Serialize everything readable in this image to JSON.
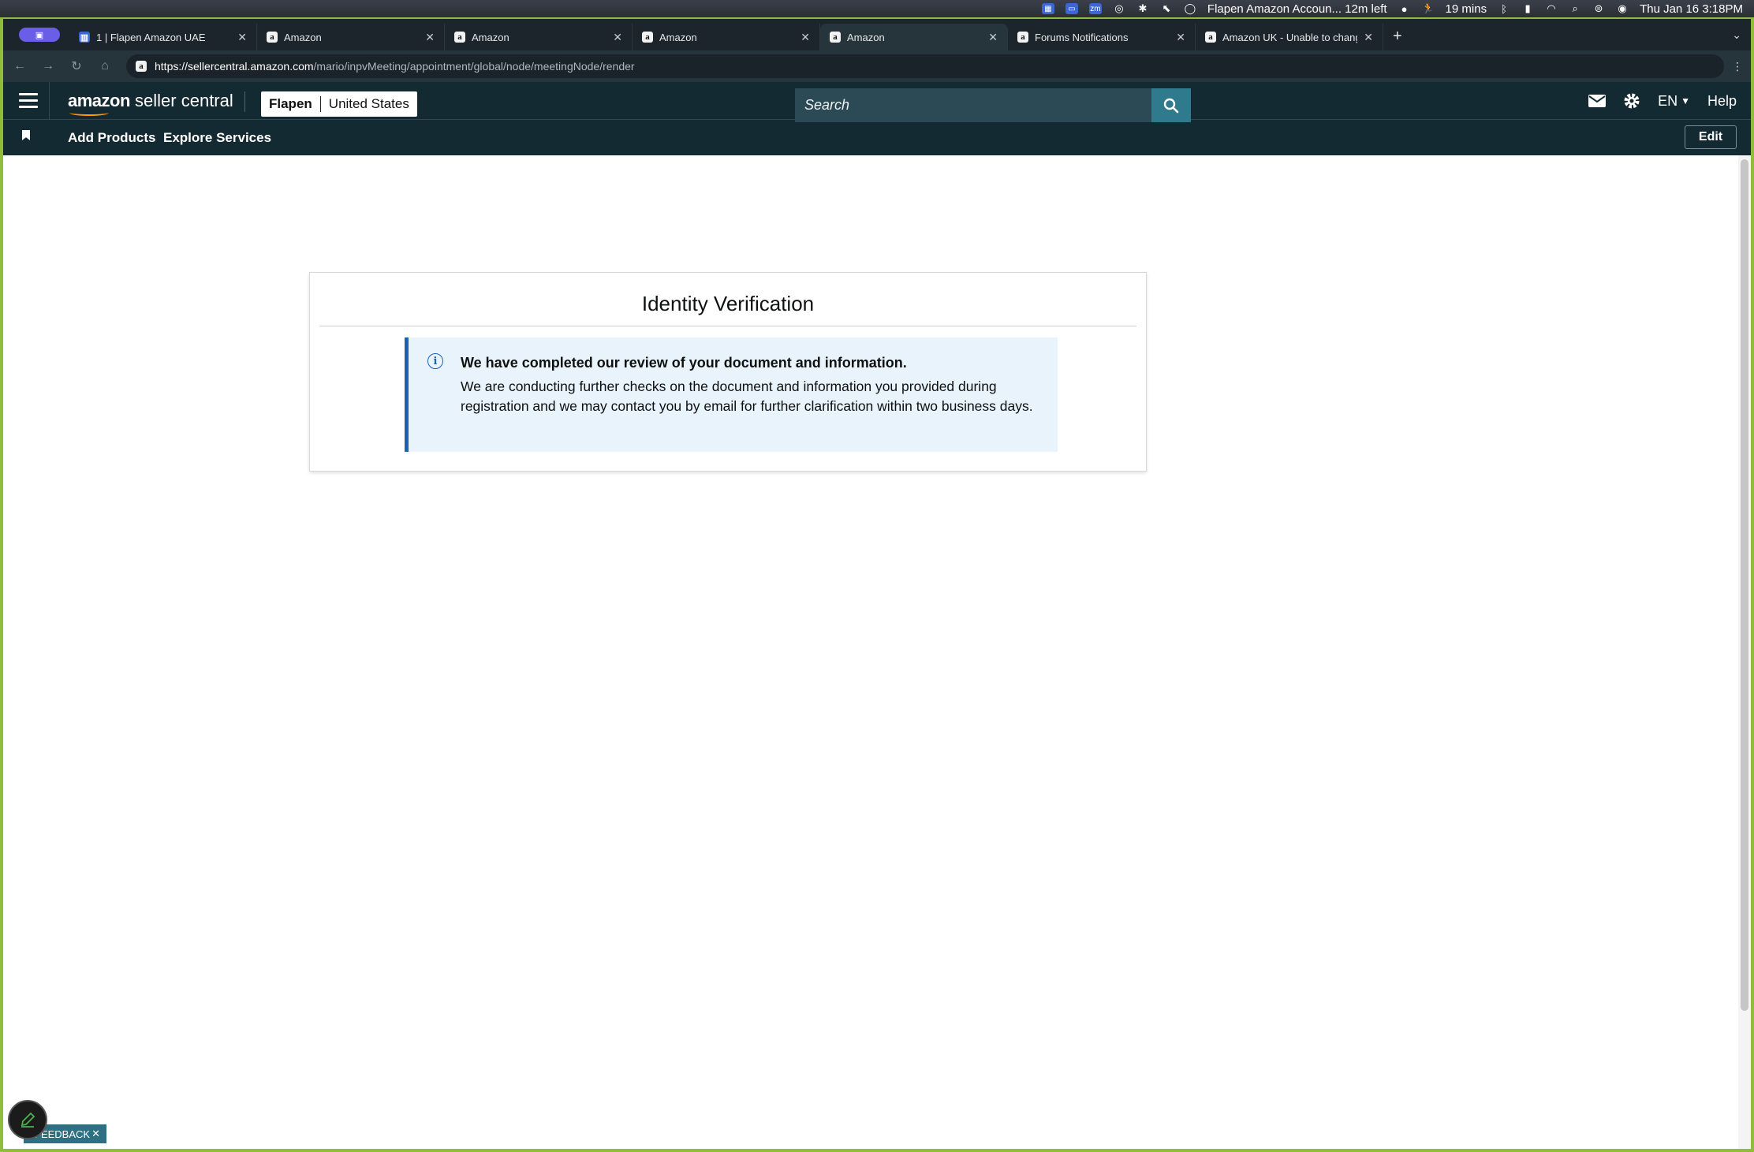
{
  "menubar": {
    "timer_label": "Flapen Amazon Accoun... 12m left",
    "mins": "19 mins",
    "datetime": "Thu Jan 16  3:18PM"
  },
  "browser": {
    "tabs": [
      {
        "label": "1 | Flapen Amazon UAE",
        "favicon": "chart-favicon",
        "active": false
      },
      {
        "label": "Amazon",
        "favicon": "amazon-favicon",
        "active": false
      },
      {
        "label": "Amazon",
        "favicon": "amazon-favicon",
        "active": false
      },
      {
        "label": "Amazon",
        "favicon": "amazon-favicon",
        "active": false
      },
      {
        "label": "Amazon",
        "favicon": "amazon-favicon",
        "active": true
      },
      {
        "label": "Forums Notifications",
        "favicon": "amazon-favicon",
        "active": false
      },
      {
        "label": "Amazon UK - Unable to chang",
        "favicon": "amazon-favicon",
        "active": false
      }
    ],
    "url_host": "https://sellercentral.amazon.com",
    "url_path": "/mario/inpvMeeting/appointment/global/node/meetingNode/render"
  },
  "header": {
    "logo_brand": "amazon",
    "logo_suffix": " seller central",
    "account_name": "Flapen",
    "account_region": "United States",
    "search_placeholder": "Search",
    "language": "EN",
    "help": "Help"
  },
  "nav": {
    "links": [
      "Add Products",
      "Explore Services"
    ],
    "edit": "Edit"
  },
  "card": {
    "title": "Identity Verification",
    "alert_heading": "We have completed our review of your document and information.",
    "alert_body": "We are conducting further checks on the document and information you provided during registration and we may contact you by email for further clarification within two business days."
  },
  "feedback": {
    "label": "FEEDBACK"
  },
  "colors": {
    "header_bg": "#132a33",
    "alert_bg": "#e8f3fc",
    "alert_accent": "#1d61b5",
    "search_button": "#2f7a8d"
  }
}
